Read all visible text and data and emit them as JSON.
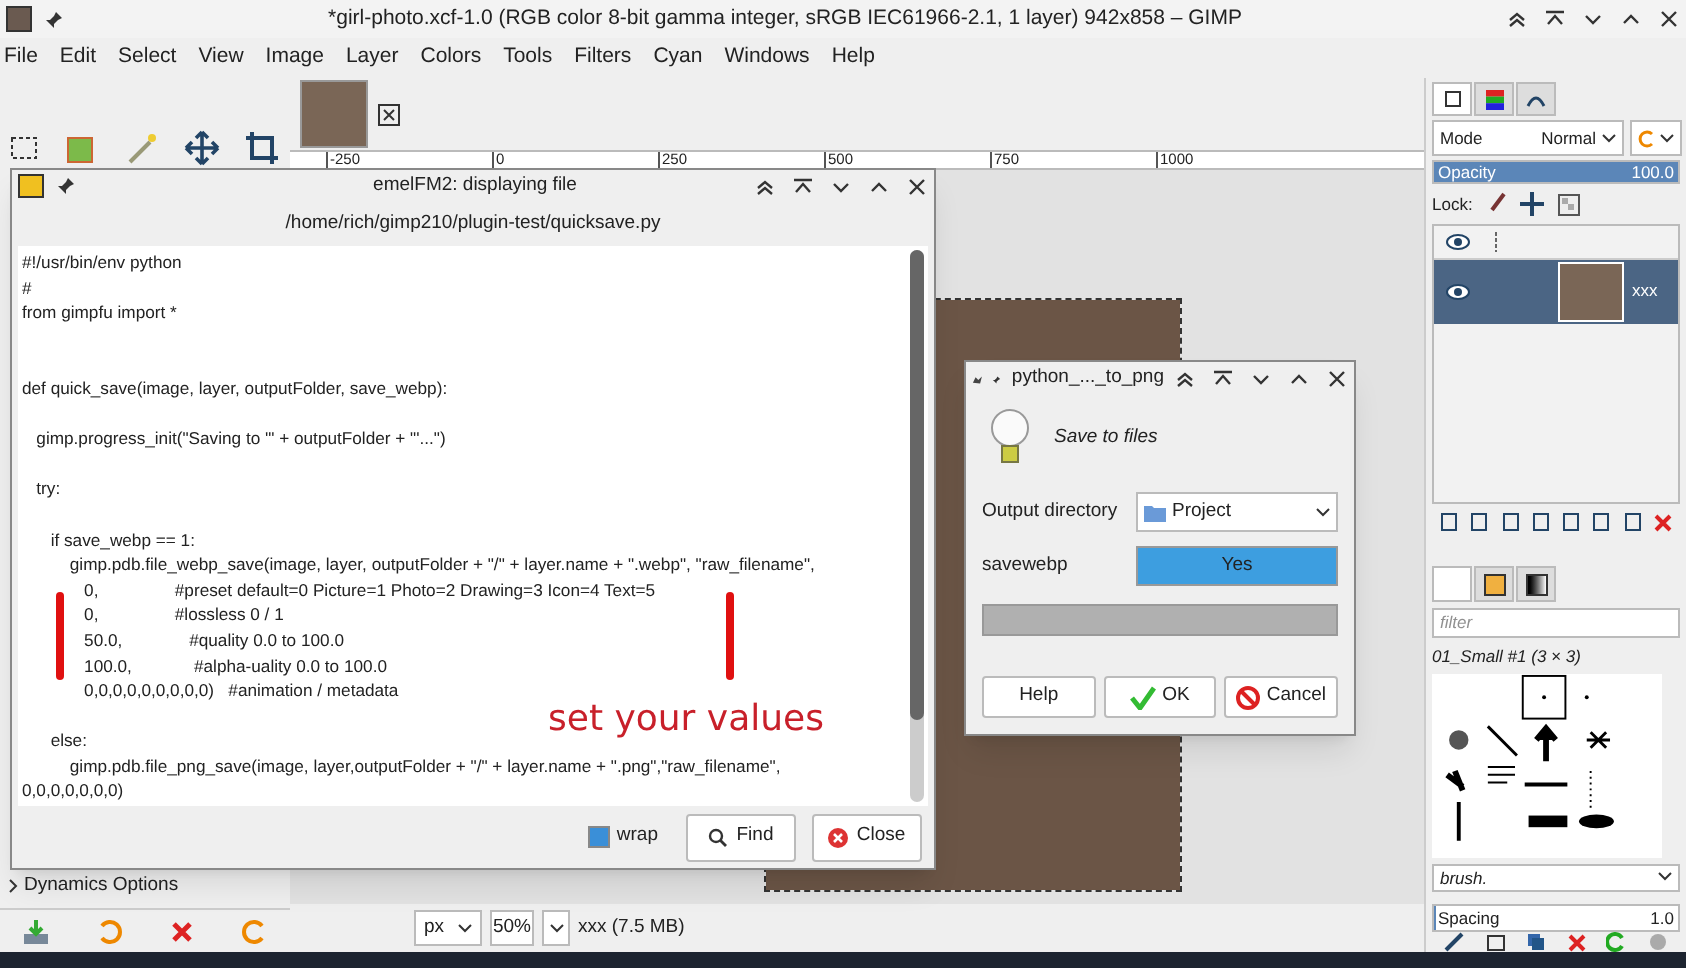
{
  "window": {
    "title": "*girl-photo.xcf-1.0 (RGB color 8-bit gamma integer, sRGB IEC61966-2.1, 1 layer) 942x858 – GIMP"
  },
  "menu": [
    "File",
    "Edit",
    "Select",
    "View",
    "Image",
    "Layer",
    "Colors",
    "Tools",
    "Filters",
    "Cyan",
    "Windows",
    "Help"
  ],
  "toolbox": {
    "dynamics_options": "Dynamics Options"
  },
  "ruler": [
    "-250",
    "0",
    "250",
    "500",
    "750",
    "1000"
  ],
  "status_bar": {
    "unit": "px",
    "zoom": "50%",
    "info": "xxx (7.5 MB)"
  },
  "file_viewer": {
    "title": "emelFM2: displaying file",
    "path": "/home/rich/gimp210/plugin-test/quicksave.py",
    "lines": [
      {
        "kind": "code",
        "text": "#!/usr/bin/env python"
      },
      {
        "kind": "code",
        "text": "#"
      },
      {
        "kind": "code",
        "text": "from gimpfu import *"
      },
      {
        "kind": "blank"
      },
      {
        "kind": "blank"
      },
      {
        "kind": "code",
        "text": "def quick_save(image, layer, outputFolder, save_webp):"
      },
      {
        "kind": "blank"
      },
      {
        "kind": "code",
        "text": "   gimp.progress_init(\"Saving to '\" + outputFolder + \"'...\")"
      },
      {
        "kind": "blank"
      },
      {
        "kind": "code",
        "text": "   try:"
      },
      {
        "kind": "blank"
      },
      {
        "kind": "code",
        "text": "      if save_webp == 1:"
      },
      {
        "kind": "code",
        "text": "          gimp.pdb.file_webp_save(image, layer, outputFolder + \"/\" + layer.name + \".webp\", \"raw_filename\","
      },
      {
        "kind": "code",
        "text": "             0,                #preset default=0 Picture=1 Photo=2 Drawing=3 Icon=4 Text=5"
      },
      {
        "kind": "code",
        "text": "             0,                #lossless 0 / 1"
      },
      {
        "kind": "code",
        "text": "             50.0,              #quality 0.0 to 100.0"
      },
      {
        "kind": "code",
        "text": "             100.0,             #alpha-uality 0.0 to 100.0"
      },
      {
        "kind": "code",
        "text": "             0,0,0,0,0,0,0,0,0)   #animation / metadata"
      },
      {
        "kind": "blank"
      },
      {
        "kind": "code",
        "text": "      else:"
      },
      {
        "kind": "code",
        "text": "          gimp.pdb.file_png_save(image, layer,outputFolder + \"/\" + layer.name + \".png\",\"raw_filename\","
      },
      {
        "kind": "code",
        "text": "0,0,0,0,0,0,0)"
      }
    ],
    "wrap": {
      "label": "wrap",
      "checked": true
    },
    "buttons": [
      {
        "kind": "find",
        "label": "Find"
      },
      {
        "kind": "close",
        "label": "Close"
      }
    ]
  },
  "annotation": {
    "text": "set your values"
  },
  "plugin_dialog": {
    "title": "python_..._to_png",
    "heading": "Save to files",
    "fields": [
      {
        "kind": "folder",
        "label": "Output directory",
        "value": "Project"
      },
      {
        "kind": "toggle",
        "label": "savewebp",
        "value": "Yes",
        "on": true
      }
    ],
    "progress": {
      "level": 0
    },
    "buttons": [
      {
        "kind": "help",
        "label": "Help"
      },
      {
        "kind": "ok",
        "label": "OK"
      },
      {
        "kind": "cancel",
        "label": "Cancel"
      }
    ]
  },
  "layers_dock": {
    "mode_label": "Mode",
    "mode": "Normal",
    "opacity": {
      "label": "Opacity",
      "value": "100.0",
      "level": 1
    },
    "lock_label": "Lock:",
    "layers": [
      {
        "name": "xxx",
        "visible": true,
        "selected": true
      }
    ]
  },
  "brushes_dock": {
    "filter_placeholder": "filter",
    "brush_name": "01_Small #1 (3 × 3)",
    "tag_value": "brush.",
    "spacing": {
      "label": "Spacing",
      "value": "1.0",
      "level": 0.01
    }
  }
}
